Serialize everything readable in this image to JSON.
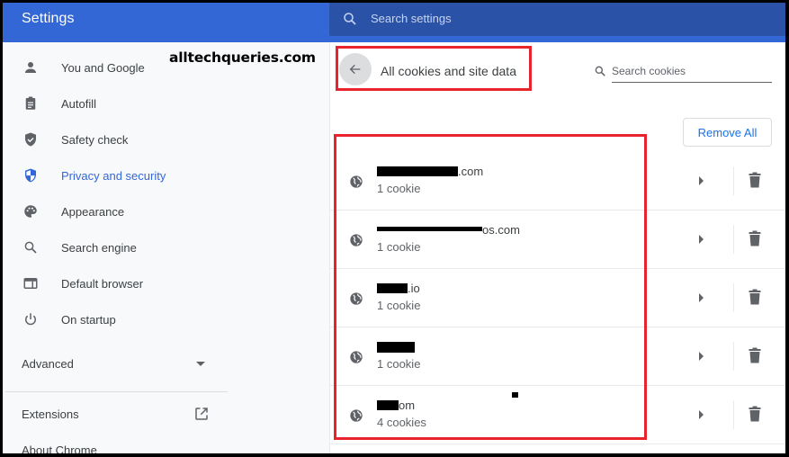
{
  "app": {
    "title": "Settings"
  },
  "search": {
    "placeholder": "Search settings",
    "icon": "search-icon"
  },
  "watermark": "alltechqueries.com",
  "sidebar": {
    "items": [
      {
        "label": "You and Google",
        "icon": "person-icon",
        "active": false
      },
      {
        "label": "Autofill",
        "icon": "clipboard-icon",
        "active": false
      },
      {
        "label": "Safety check",
        "icon": "shield-check-icon",
        "active": false
      },
      {
        "label": "Privacy and security",
        "icon": "shield-half-icon",
        "active": true
      },
      {
        "label": "Appearance",
        "icon": "palette-icon",
        "active": false
      },
      {
        "label": "Search engine",
        "icon": "search-icon",
        "active": false
      },
      {
        "label": "Default browser",
        "icon": "browser-window-icon",
        "active": false
      },
      {
        "label": "On startup",
        "icon": "power-icon",
        "active": false
      }
    ],
    "advanced_label": "Advanced",
    "extensions_label": "Extensions",
    "about_label": "About Chrome"
  },
  "main": {
    "title": "All cookies and site data",
    "cookie_search_placeholder": "Search cookies",
    "remove_all_label": "Remove All",
    "sites": [
      {
        "name_suffix": ".com",
        "count": "1 cookie"
      },
      {
        "name_suffix": "os.com",
        "count": "1 cookie"
      },
      {
        "name_suffix": ".io",
        "count": "1 cookie"
      },
      {
        "name_suffix": "",
        "count": "1 cookie"
      },
      {
        "name_suffix": "om",
        "count": "4 cookies"
      }
    ]
  },
  "colors": {
    "header_blue": "#3367d6",
    "search_bar_blue": "#2a53a8",
    "accent_blue": "#1a73e8",
    "annotation_red": "#e8232b"
  }
}
